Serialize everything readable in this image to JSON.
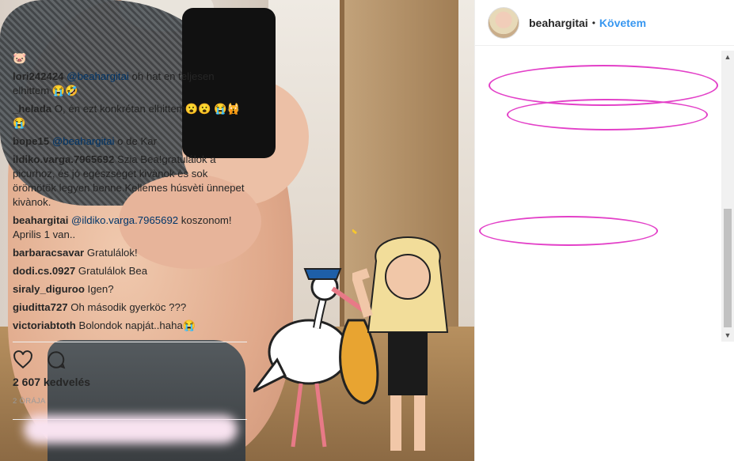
{
  "header": {
    "username": "beahargitai",
    "separator": "•",
    "follow_label": "Követem"
  },
  "comments": [
    {
      "text": "🐷"
    },
    {
      "user": "lori242424",
      "mention": "@beahargitai",
      "text": " oh hat en teljesen elhittem 😭🤣"
    },
    {
      "user": "_helada",
      "text": " O, én ezt konkrétan elhittem😮😮 😭🙀😭"
    },
    {
      "user": "bope15",
      "mention": "@beahargitai",
      "text": " o de Kar"
    },
    {
      "user": "ildiko.varga.7965692",
      "text": " Szia Bea!gratulálok a picurhoz, és jó egèszsèget kivànok ès sok örömötök legyen benne.Kellemes húsvèti ünnepet kivànok."
    },
    {
      "user": "beahargitai",
      "mention": "@ildiko.varga.7965692",
      "text": " koszonom! Aprilis 1 van.."
    },
    {
      "user": "barbaracsavar",
      "text": " Gratulálok!"
    },
    {
      "user": "dodi.cs.0927",
      "text": " Gratulálok Bea"
    },
    {
      "user": "siraly_diguroo",
      "text": " Igen?"
    },
    {
      "user": "giuditta727",
      "text": " Oh második gyerköc ???"
    },
    {
      "user": "victoriabtoth",
      "text": " Bolondok napját..haha😭"
    }
  ],
  "footer": {
    "likes": "2 607 kedvelés",
    "time": "2 ÓRÁJA"
  },
  "colors": {
    "accent": "#3897f0",
    "highlight": "#e340c8"
  },
  "icons": [
    "heart-icon",
    "comment-icon"
  ]
}
